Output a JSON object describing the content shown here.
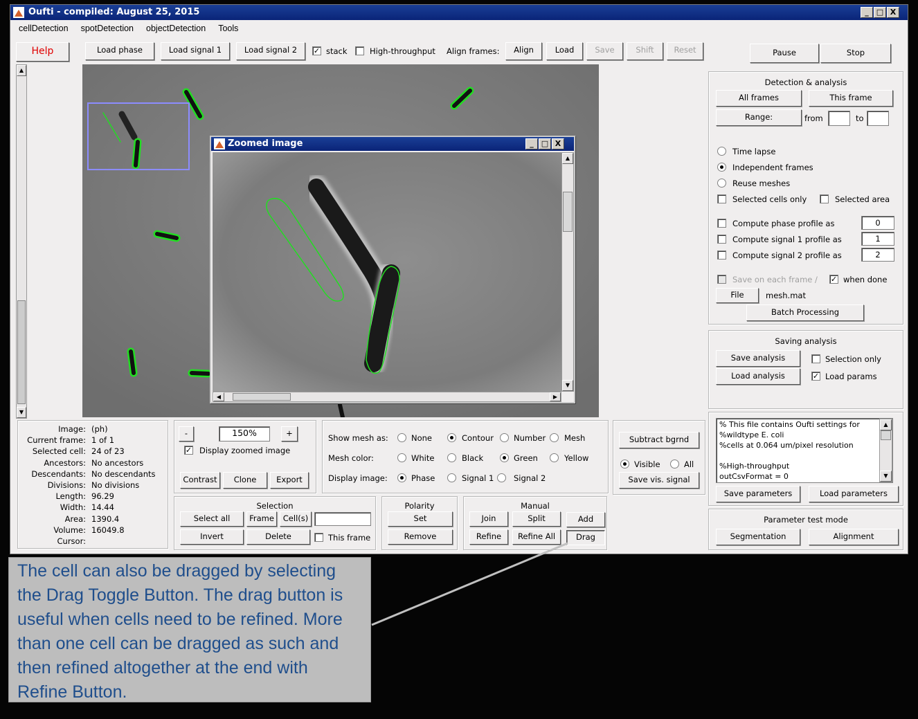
{
  "window": {
    "title": "Oufti - compiled: August 25, 2015",
    "controls": [
      "_",
      "□",
      "X"
    ]
  },
  "menu": [
    "cellDetection",
    "spotDetection",
    "objectDetection",
    "Tools"
  ],
  "toolbar": {
    "help": "Help",
    "load_phase": "Load phase",
    "load_signal1": "Load signal 1",
    "load_signal2": "Load signal 2",
    "stack_label": "stack",
    "stack_checked": true,
    "high_throughput_label": "High-throughput",
    "high_throughput_checked": false,
    "align_frames_label": "Align frames:",
    "align": "Align",
    "load": "Load",
    "save": "Save",
    "shift": "Shift",
    "reset": "Reset",
    "pause": "Pause",
    "stop": "Stop"
  },
  "zoom_window": {
    "title": "Zoomed image",
    "controls": [
      "_",
      "□",
      "X"
    ]
  },
  "info": {
    "labels": [
      "Image:",
      "Current frame:",
      "Selected cell:",
      "Ancestors:",
      "Descendants:",
      "Divisions:",
      "Length:",
      "Width:",
      "Area:",
      "Volume:",
      "Cursor:"
    ],
    "values": [
      "(ph)",
      "1 of 1",
      "24 of 23",
      "No ancestors",
      "No descendants",
      "No divisions",
      "96.29",
      "14.44",
      "1390.4",
      "16049.8",
      ""
    ]
  },
  "zoom_panel": {
    "minus": "-",
    "value": "150%",
    "plus": "+",
    "display_zoomed_label": "Display zoomed image",
    "display_zoomed_checked": true,
    "contrast": "Contrast",
    "clone": "Clone",
    "export": "Export"
  },
  "mesh_panel": {
    "show_mesh_label": "Show mesh as:",
    "show_mesh_options": [
      "None",
      "Contour",
      "Number",
      "Mesh"
    ],
    "show_mesh_selected": "Contour",
    "mesh_color_label": "Mesh color:",
    "mesh_color_options": [
      "White",
      "Black",
      "Green",
      "Yellow"
    ],
    "mesh_color_selected": "Green",
    "display_image_label": "Display image:",
    "display_image_options": [
      "Phase",
      "Signal 1",
      "Signal 2"
    ],
    "display_image_selected": "Phase"
  },
  "subtract_panel": {
    "subtract": "Subtract bgrnd",
    "visible_label": "Visible",
    "all_label": "All",
    "visible_selected": true,
    "save_vis": "Save vis. signal"
  },
  "selection_panel": {
    "title": "Selection",
    "select_all": "Select all",
    "frame": "Frame",
    "cells": "Cell(s)",
    "invert": "Invert",
    "delete": "Delete",
    "this_frame_label": "This frame",
    "this_frame_checked": false
  },
  "polarity_panel": {
    "title": "Polarity",
    "set": "Set",
    "remove": "Remove"
  },
  "manual_panel": {
    "title": "Manual",
    "join": "Join",
    "split": "Split",
    "add": "Add",
    "refine": "Refine",
    "refine_all": "Refine All",
    "drag": "Drag"
  },
  "detection_panel": {
    "title": "Detection & analysis",
    "all_frames": "All frames",
    "this_frame": "This frame",
    "range": "Range:",
    "from_label": "from",
    "to_label": "to",
    "from_value": "",
    "to_value": "",
    "mode_options": [
      "Time lapse",
      "Independent frames",
      "Reuse meshes"
    ],
    "mode_selected": "Independent frames",
    "selected_cells_only": "Selected cells only",
    "selected_area": "Selected area",
    "profiles": [
      {
        "label": "Compute phase profile as",
        "value": "0"
      },
      {
        "label": "Compute signal 1 profile as",
        "value": "1"
      },
      {
        "label": "Compute signal 2 profile as",
        "value": "2"
      }
    ],
    "save_each_frame": "Save on each frame /",
    "when_done": "when done",
    "when_done_checked": true,
    "file": "File",
    "file_name": "mesh.mat",
    "batch": "Batch Processing"
  },
  "saving_panel": {
    "title": "Saving analysis",
    "save_analysis": "Save analysis",
    "selection_only": "Selection only",
    "selection_only_checked": false,
    "load_analysis": "Load analysis",
    "load_params": "Load params",
    "load_params_checked": true
  },
  "settings_panel": {
    "lines": [
      "% This file contains Oufti settings for",
      "%wildtype E. coli",
      "%cells at 0.064 um/pixel resolution",
      "",
      "%High-throughput",
      "outCsvFormat = 0"
    ],
    "save_parameters": "Save parameters",
    "load_parameters": "Load parameters"
  },
  "param_test_panel": {
    "title": "Parameter test mode",
    "segmentation": "Segmentation",
    "alignment": "Alignment"
  },
  "caption": "The cell can also be dragged by selecting the Drag Toggle Button.  The drag button is useful when cells need to be refined. More than one cell can be dragged as such and then refined altogether at the end with Refine Button.",
  "colors": {
    "title_bar": "#0a2478",
    "contour": "#22dd22",
    "caption_text": "#1f4e8c",
    "help_text": "#e00000"
  }
}
